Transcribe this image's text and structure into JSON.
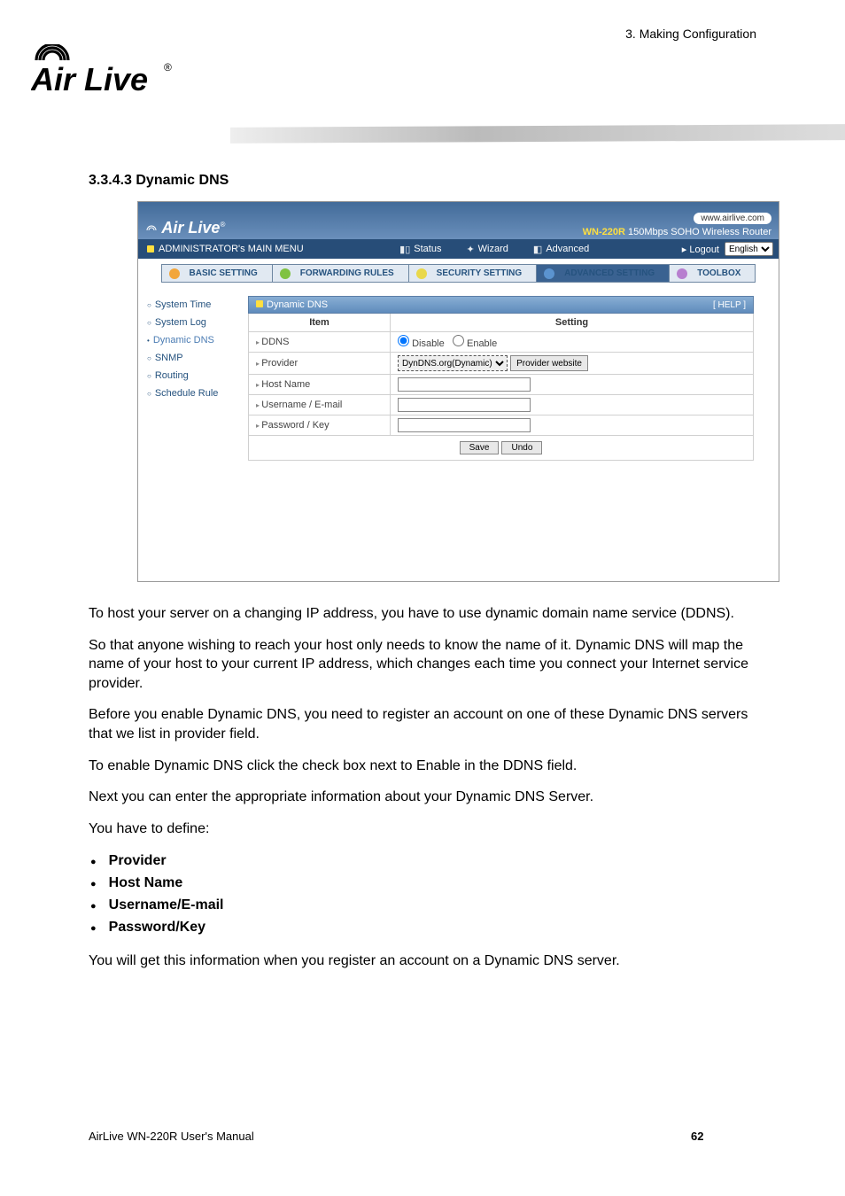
{
  "page_header": "3. Making Configuration",
  "brand": "Air Live",
  "section_number": "3.3.4.3  Dynamic DNS",
  "screenshot": {
    "logo": "Air Live",
    "pill": "www.airlive.com",
    "tagline_model": "WN-220R",
    "tagline_rest": " 150Mbps SOHO Wireless Router",
    "menubar": {
      "main": "ADMINISTRATOR's MAIN MENU",
      "status": "Status",
      "wizard": "Wizard",
      "advanced": "Advanced",
      "logout": "▸ Logout",
      "lang": "English"
    },
    "tabs": {
      "basic": "BASIC SETTING",
      "forwarding": "FORWARDING RULES",
      "security": "SECURITY SETTING",
      "advanced": "ADVANCED SETTING",
      "toolbox": "TOOLBOX"
    },
    "sidebar": [
      "System Time",
      "System Log",
      "Dynamic DNS",
      "SNMP",
      "Routing",
      "Schedule Rule"
    ],
    "panel_title": "Dynamic DNS",
    "help": "[ HELP ]",
    "th_item": "Item",
    "th_setting": "Setting",
    "rows": {
      "ddns": "DDNS",
      "ddns_disable": "Disable",
      "ddns_enable": "Enable",
      "provider": "Provider",
      "provider_opt": "DynDNS.org(Dynamic)",
      "provider_btn": "Provider website",
      "hostname": "Host Name",
      "username": "Username / E-mail",
      "password": "Password / Key"
    },
    "btn_save": "Save",
    "btn_undo": "Undo"
  },
  "paragraphs": {
    "p1": "To host your server on a changing IP address, you have to use dynamic domain name service (DDNS).",
    "p2": "So that anyone wishing to reach your host only needs to know the name of it. Dynamic DNS will map the name of your host to your current IP address, which changes each time you connect your Internet service provider.",
    "p3": "Before you enable Dynamic DNS, you need to register an account on one of these Dynamic DNS servers that we list in provider field.",
    "p4": "To enable Dynamic DNS click the check box next to Enable in the DDNS field.",
    "p5": "Next you can enter the appropriate information about your Dynamic DNS Server.",
    "p6": "You have to define:",
    "p7": "You will get this information when you register an account on a Dynamic DNS server."
  },
  "bullets": [
    "Provider",
    "Host Name",
    "Username/E-mail",
    "Password/Key"
  ],
  "footer": {
    "left": "AirLive WN-220R User's Manual",
    "page": "62"
  }
}
